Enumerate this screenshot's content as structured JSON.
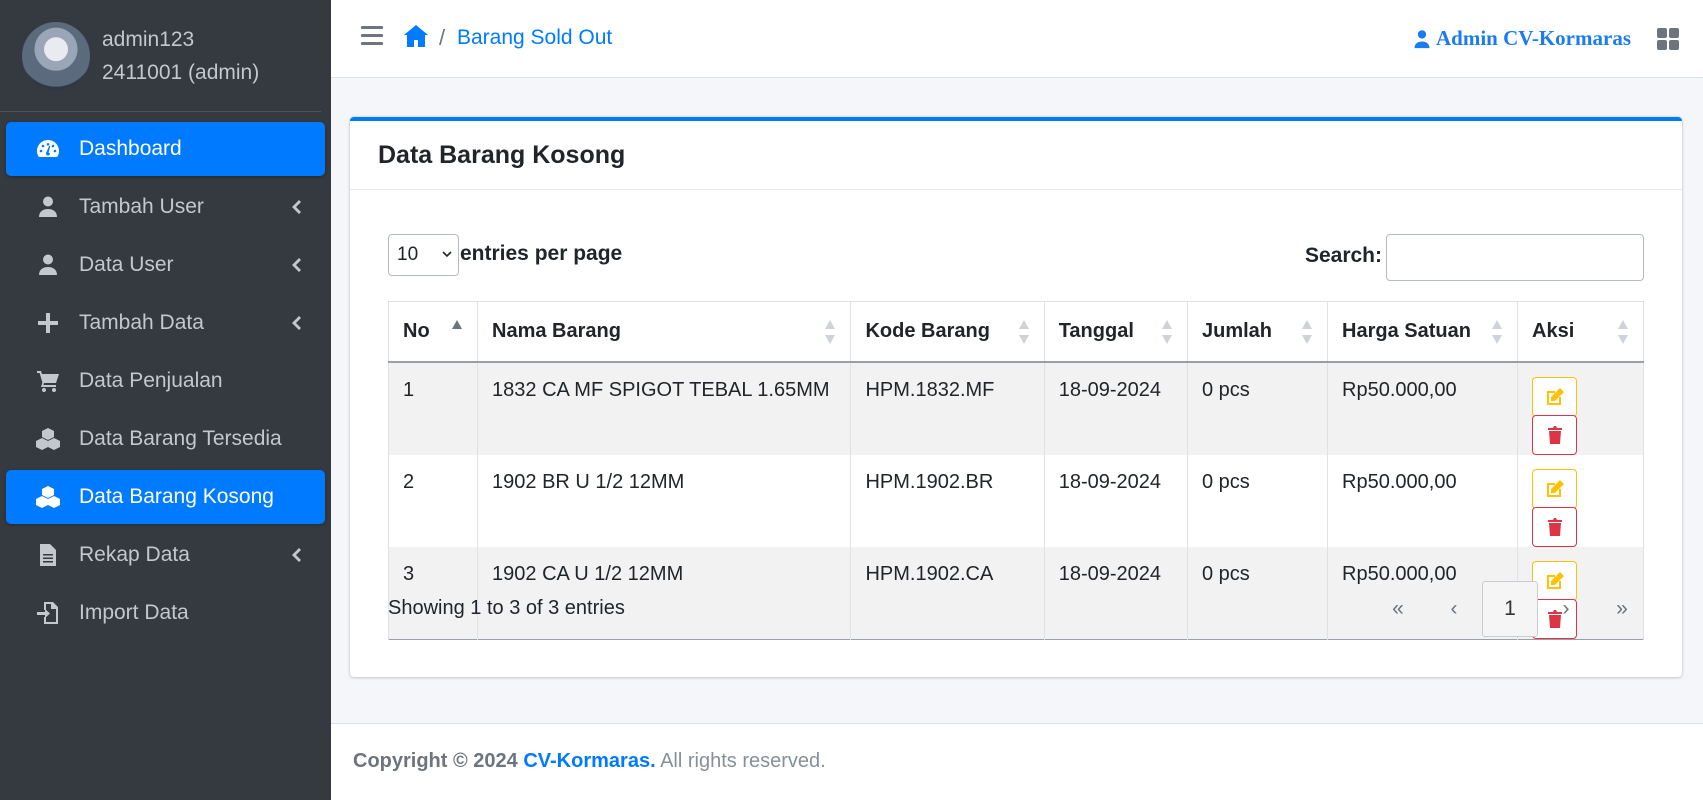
{
  "user": {
    "name": "admin123",
    "id_role": "2411001 (admin)"
  },
  "sidebar": {
    "items": [
      {
        "label": "Dashboard"
      },
      {
        "label": "Tambah User"
      },
      {
        "label": "Data User"
      },
      {
        "label": "Tambah Data"
      },
      {
        "label": "Data Penjualan"
      },
      {
        "label": "Data Barang Tersedia"
      },
      {
        "label": "Data Barang Kosong"
      },
      {
        "label": "Rekap Data"
      },
      {
        "label": "Import Data"
      }
    ]
  },
  "header": {
    "breadcrumb_sep": "/",
    "breadcrumb_current": "Barang Sold Out",
    "admin_label": "Admin CV-Kormaras"
  },
  "card": {
    "title": "Data Barang Kosong"
  },
  "table_controls": {
    "page_length": "10",
    "page_length_label": "entries per page",
    "search_label": "Search:",
    "search_value": ""
  },
  "table": {
    "columns": [
      "No",
      "Nama Barang",
      "Kode Barang",
      "Tanggal",
      "Jumlah",
      "Harga Satuan",
      "Aksi"
    ],
    "rows": [
      {
        "no": "1",
        "nama": "1832 CA MF SPIGOT TEBAL 1.65MM",
        "kode": "HPM.1832.MF",
        "tanggal": "18-09-2024",
        "jumlah": "0 pcs",
        "harga": "Rp50.000,00"
      },
      {
        "no": "2",
        "nama": "1902 BR U 1/2 12MM",
        "kode": "HPM.1902.BR",
        "tanggal": "18-09-2024",
        "jumlah": "0 pcs",
        "harga": "Rp50.000,00"
      },
      {
        "no": "3",
        "nama": "1902 CA U 1/2 12MM",
        "kode": "HPM.1902.CA",
        "tanggal": "18-09-2024",
        "jumlah": "0 pcs",
        "harga": "Rp50.000,00"
      }
    ]
  },
  "table_info": "Showing 1 to 3 of 3 entries",
  "pagination": {
    "first": "«",
    "prev": "‹",
    "current": "1",
    "next": "›",
    "last": "»"
  },
  "footer": {
    "prefix": "Copyright © 2024",
    "brand": "CV-Kormaras.",
    "suffix": "All rights reserved."
  },
  "colors": {
    "primary": "#007bff",
    "sidebar_bg": "#343a40",
    "edit": "#ffc107",
    "delete": "#dc3545"
  }
}
